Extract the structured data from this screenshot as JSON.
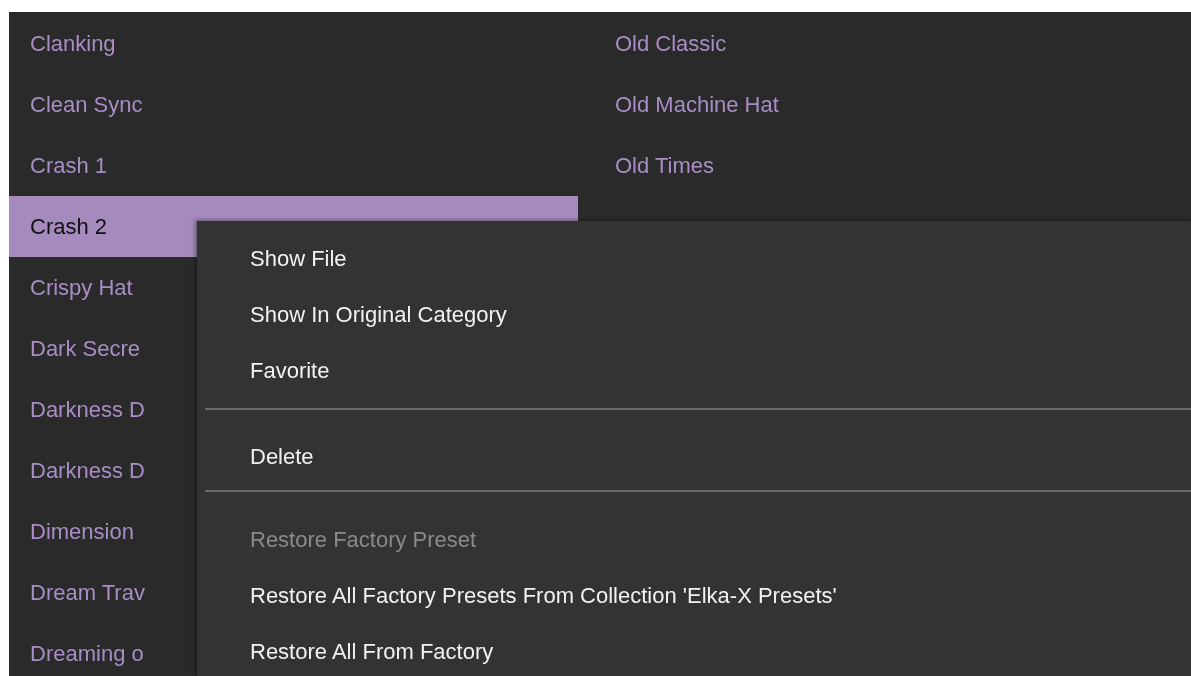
{
  "preset_list": {
    "column_1": [
      {
        "label": "Clanking",
        "selected": false
      },
      {
        "label": "Clean Sync",
        "selected": false
      },
      {
        "label": "Crash 1",
        "selected": false
      },
      {
        "label": "Crash 2",
        "selected": true
      },
      {
        "label": "Crispy Hat",
        "selected": false
      },
      {
        "label": "Dark Secre",
        "selected": false
      },
      {
        "label": "Darkness D",
        "selected": false
      },
      {
        "label": "Darkness D",
        "selected": false
      },
      {
        "label": "Dimension",
        "selected": false
      },
      {
        "label": "Dream Trav",
        "selected": false
      },
      {
        "label": "Dreaming o",
        "selected": false
      }
    ],
    "column_2": [
      {
        "label": "Old Classic",
        "selected": false
      },
      {
        "label": "Old Machine Hat",
        "selected": false
      },
      {
        "label": "Old Times",
        "selected": false
      }
    ]
  },
  "context_menu": {
    "items": [
      {
        "kind": "item",
        "label": "Show File",
        "disabled": false
      },
      {
        "kind": "item",
        "label": "Show In Original Category",
        "disabled": false
      },
      {
        "kind": "item",
        "label": "Favorite",
        "disabled": false
      },
      {
        "kind": "separator"
      },
      {
        "kind": "item",
        "label": "Delete",
        "disabled": false
      },
      {
        "kind": "separator"
      },
      {
        "kind": "item",
        "label": "Restore Factory Preset",
        "disabled": true
      },
      {
        "kind": "item",
        "label": "Restore All Factory Presets From Collection 'Elka-X Presets'",
        "disabled": false
      },
      {
        "kind": "item",
        "label": "Restore All From Factory",
        "disabled": false
      }
    ]
  }
}
